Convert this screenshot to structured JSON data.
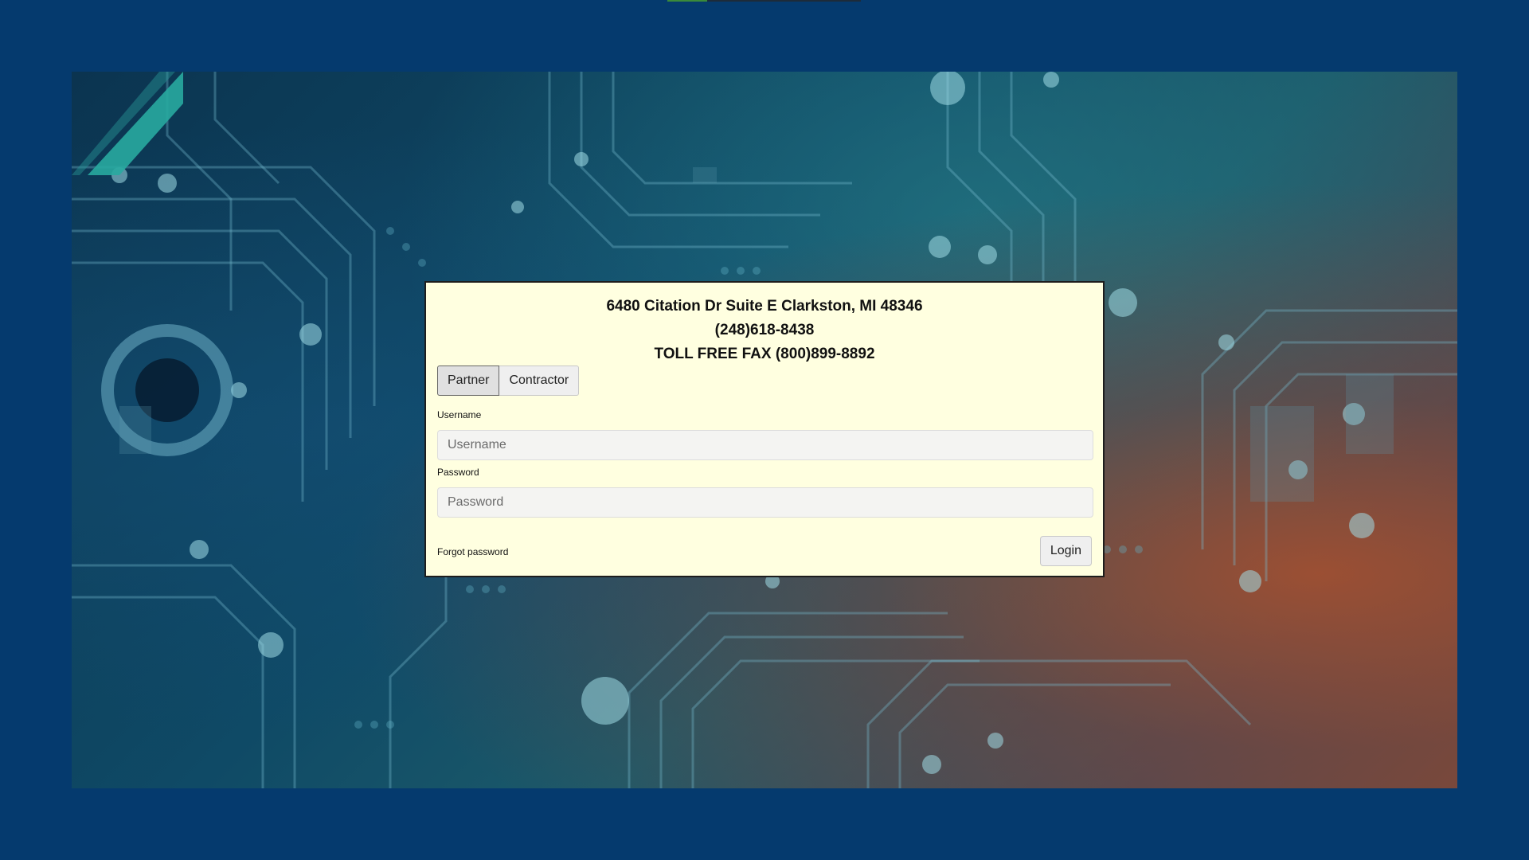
{
  "card": {
    "address_line1": "6480 Citation Dr Suite E Clarkston, MI 48346",
    "phone": "(248)618-8438",
    "fax": "TOLL FREE FAX (800)899-8892"
  },
  "tabs": [
    {
      "label": "Partner",
      "selected": true
    },
    {
      "label": "Contractor",
      "selected": false
    }
  ],
  "form": {
    "username_label": "Username",
    "username_placeholder": "Username",
    "username_value": "",
    "password_label": "Password",
    "password_placeholder": "Password",
    "password_value": "",
    "forgot_label": "Forgot password",
    "login_label": "Login"
  },
  "colors": {
    "page_background": "#053a6e",
    "card_background": "#ffffe0"
  },
  "icons": {
    "background_image": "circuit-board-image"
  }
}
